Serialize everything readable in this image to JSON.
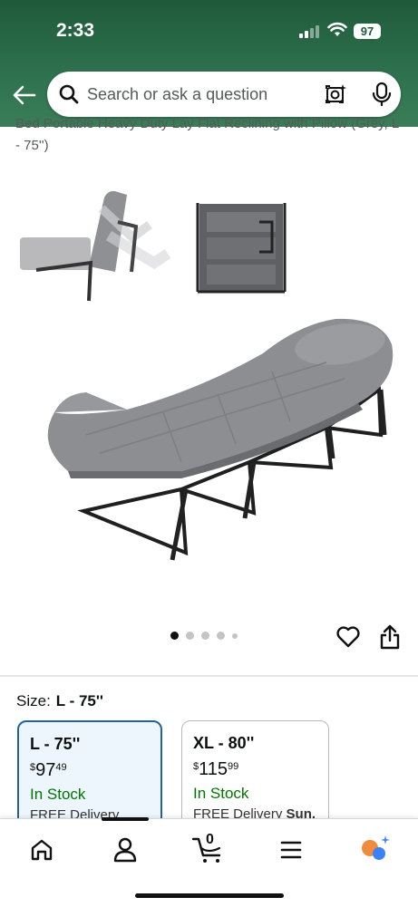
{
  "status_bar": {
    "time": "2:33",
    "battery": "97"
  },
  "search": {
    "placeholder": "Search or ask a question"
  },
  "product": {
    "title_fragment": "Bed Portable Heavy Duty Lay Flat Reclining with Pillow (Grey, L - 75'')"
  },
  "gallery": {
    "image_count": 5,
    "current_index": 0
  },
  "size_selector": {
    "label": "Size:",
    "selected": "L - 75''",
    "options": [
      {
        "name": "L - 75''",
        "price_symbol": "$",
        "price_whole": "97",
        "price_fraction": "49",
        "stock": "In Stock",
        "delivery": "FREE Delivery"
      },
      {
        "name": "XL - 80''",
        "price_symbol": "$",
        "price_whole": "115",
        "price_fraction": "99",
        "stock": "In Stock",
        "delivery": "FREE Delivery",
        "delivery_day": "Sun."
      }
    ]
  },
  "tabbar": {
    "cart_count": "0"
  },
  "colors": {
    "header": "#2f7250",
    "selected_border": "#2162a1",
    "in_stock": "#007600"
  }
}
